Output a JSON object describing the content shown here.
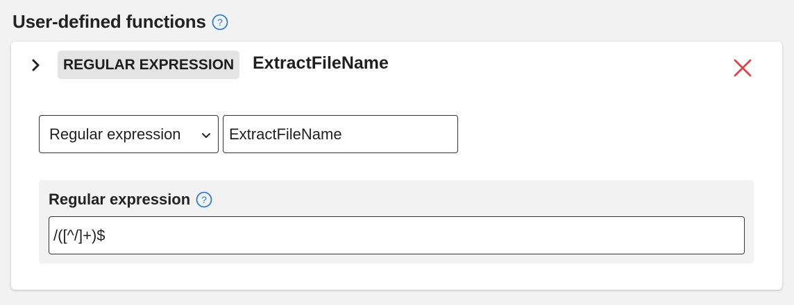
{
  "section": {
    "title": "User-defined functions",
    "help_icon": "question-circle-icon"
  },
  "function": {
    "type_badge": "REGULAR EXPRESSION",
    "name": "ExtractFileName",
    "expand_icon": "chevron-right-icon",
    "remove_icon": "close-icon",
    "type_select": {
      "selected": "Regular expression"
    },
    "name_input": {
      "value": "ExtractFileName"
    },
    "regex": {
      "label": "Regular expression",
      "value": "/([^/]+)$"
    }
  },
  "colors": {
    "accent": "#2f7dc6",
    "remove": "#d9444a",
    "badge_bg": "#e4e4e4",
    "panel_bg": "#f2f2f2"
  }
}
